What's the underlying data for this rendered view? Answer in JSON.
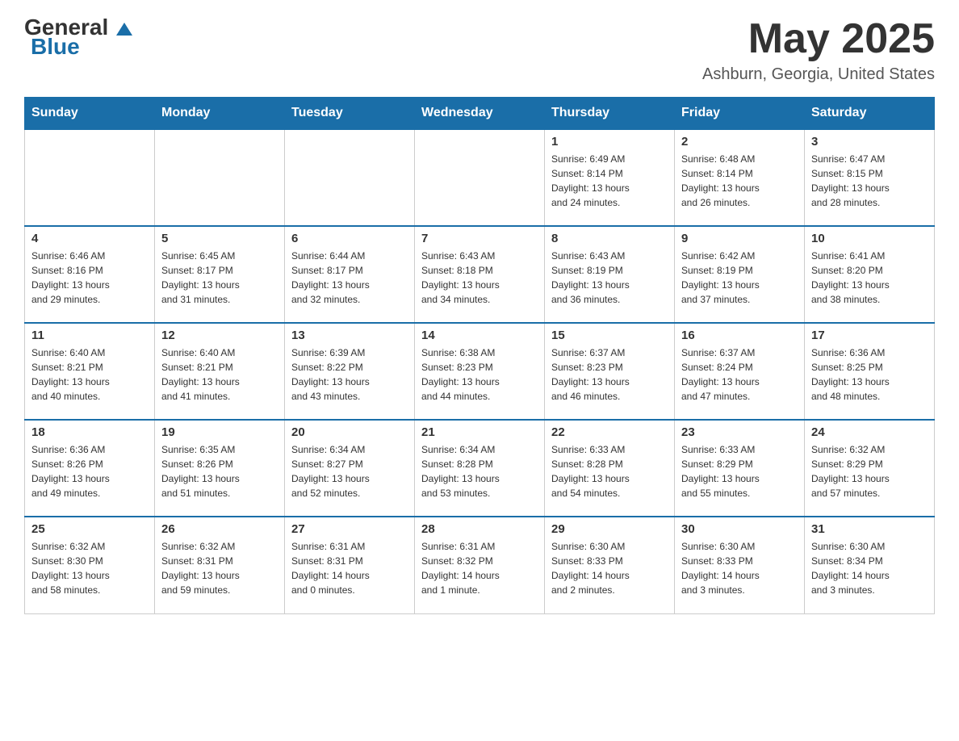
{
  "header": {
    "logo_general": "General",
    "logo_blue": "Blue",
    "month_title": "May 2025",
    "location": "Ashburn, Georgia, United States"
  },
  "calendar": {
    "days_of_week": [
      "Sunday",
      "Monday",
      "Tuesday",
      "Wednesday",
      "Thursday",
      "Friday",
      "Saturday"
    ],
    "weeks": [
      [
        {
          "day": "",
          "info": ""
        },
        {
          "day": "",
          "info": ""
        },
        {
          "day": "",
          "info": ""
        },
        {
          "day": "",
          "info": ""
        },
        {
          "day": "1",
          "info": "Sunrise: 6:49 AM\nSunset: 8:14 PM\nDaylight: 13 hours\nand 24 minutes."
        },
        {
          "day": "2",
          "info": "Sunrise: 6:48 AM\nSunset: 8:14 PM\nDaylight: 13 hours\nand 26 minutes."
        },
        {
          "day": "3",
          "info": "Sunrise: 6:47 AM\nSunset: 8:15 PM\nDaylight: 13 hours\nand 28 minutes."
        }
      ],
      [
        {
          "day": "4",
          "info": "Sunrise: 6:46 AM\nSunset: 8:16 PM\nDaylight: 13 hours\nand 29 minutes."
        },
        {
          "day": "5",
          "info": "Sunrise: 6:45 AM\nSunset: 8:17 PM\nDaylight: 13 hours\nand 31 minutes."
        },
        {
          "day": "6",
          "info": "Sunrise: 6:44 AM\nSunset: 8:17 PM\nDaylight: 13 hours\nand 32 minutes."
        },
        {
          "day": "7",
          "info": "Sunrise: 6:43 AM\nSunset: 8:18 PM\nDaylight: 13 hours\nand 34 minutes."
        },
        {
          "day": "8",
          "info": "Sunrise: 6:43 AM\nSunset: 8:19 PM\nDaylight: 13 hours\nand 36 minutes."
        },
        {
          "day": "9",
          "info": "Sunrise: 6:42 AM\nSunset: 8:19 PM\nDaylight: 13 hours\nand 37 minutes."
        },
        {
          "day": "10",
          "info": "Sunrise: 6:41 AM\nSunset: 8:20 PM\nDaylight: 13 hours\nand 38 minutes."
        }
      ],
      [
        {
          "day": "11",
          "info": "Sunrise: 6:40 AM\nSunset: 8:21 PM\nDaylight: 13 hours\nand 40 minutes."
        },
        {
          "day": "12",
          "info": "Sunrise: 6:40 AM\nSunset: 8:21 PM\nDaylight: 13 hours\nand 41 minutes."
        },
        {
          "day": "13",
          "info": "Sunrise: 6:39 AM\nSunset: 8:22 PM\nDaylight: 13 hours\nand 43 minutes."
        },
        {
          "day": "14",
          "info": "Sunrise: 6:38 AM\nSunset: 8:23 PM\nDaylight: 13 hours\nand 44 minutes."
        },
        {
          "day": "15",
          "info": "Sunrise: 6:37 AM\nSunset: 8:23 PM\nDaylight: 13 hours\nand 46 minutes."
        },
        {
          "day": "16",
          "info": "Sunrise: 6:37 AM\nSunset: 8:24 PM\nDaylight: 13 hours\nand 47 minutes."
        },
        {
          "day": "17",
          "info": "Sunrise: 6:36 AM\nSunset: 8:25 PM\nDaylight: 13 hours\nand 48 minutes."
        }
      ],
      [
        {
          "day": "18",
          "info": "Sunrise: 6:36 AM\nSunset: 8:26 PM\nDaylight: 13 hours\nand 49 minutes."
        },
        {
          "day": "19",
          "info": "Sunrise: 6:35 AM\nSunset: 8:26 PM\nDaylight: 13 hours\nand 51 minutes."
        },
        {
          "day": "20",
          "info": "Sunrise: 6:34 AM\nSunset: 8:27 PM\nDaylight: 13 hours\nand 52 minutes."
        },
        {
          "day": "21",
          "info": "Sunrise: 6:34 AM\nSunset: 8:28 PM\nDaylight: 13 hours\nand 53 minutes."
        },
        {
          "day": "22",
          "info": "Sunrise: 6:33 AM\nSunset: 8:28 PM\nDaylight: 13 hours\nand 54 minutes."
        },
        {
          "day": "23",
          "info": "Sunrise: 6:33 AM\nSunset: 8:29 PM\nDaylight: 13 hours\nand 55 minutes."
        },
        {
          "day": "24",
          "info": "Sunrise: 6:32 AM\nSunset: 8:29 PM\nDaylight: 13 hours\nand 57 minutes."
        }
      ],
      [
        {
          "day": "25",
          "info": "Sunrise: 6:32 AM\nSunset: 8:30 PM\nDaylight: 13 hours\nand 58 minutes."
        },
        {
          "day": "26",
          "info": "Sunrise: 6:32 AM\nSunset: 8:31 PM\nDaylight: 13 hours\nand 59 minutes."
        },
        {
          "day": "27",
          "info": "Sunrise: 6:31 AM\nSunset: 8:31 PM\nDaylight: 14 hours\nand 0 minutes."
        },
        {
          "day": "28",
          "info": "Sunrise: 6:31 AM\nSunset: 8:32 PM\nDaylight: 14 hours\nand 1 minute."
        },
        {
          "day": "29",
          "info": "Sunrise: 6:30 AM\nSunset: 8:33 PM\nDaylight: 14 hours\nand 2 minutes."
        },
        {
          "day": "30",
          "info": "Sunrise: 6:30 AM\nSunset: 8:33 PM\nDaylight: 14 hours\nand 3 minutes."
        },
        {
          "day": "31",
          "info": "Sunrise: 6:30 AM\nSunset: 8:34 PM\nDaylight: 14 hours\nand 3 minutes."
        }
      ]
    ]
  }
}
